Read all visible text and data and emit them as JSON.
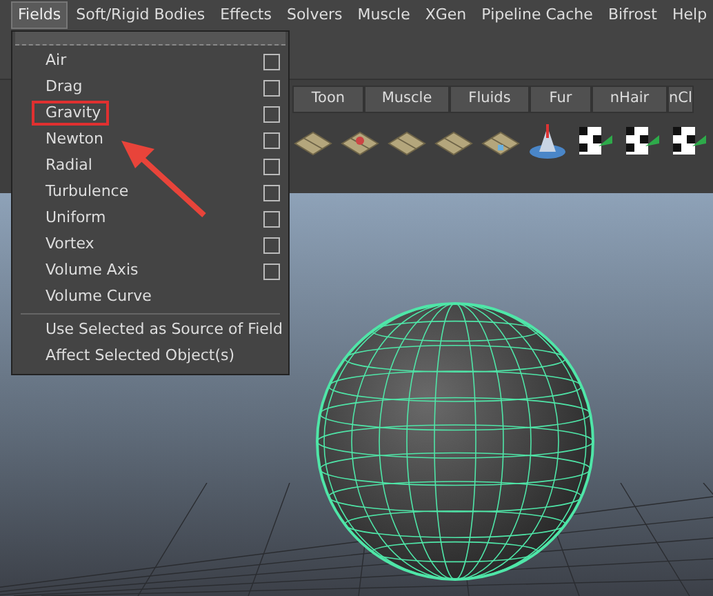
{
  "menu_bar": [
    {
      "label": "Fields",
      "selected": true
    },
    {
      "label": "Soft/Rigid Bodies",
      "selected": false
    },
    {
      "label": "Effects",
      "selected": false
    },
    {
      "label": "Solvers",
      "selected": false
    },
    {
      "label": "Muscle",
      "selected": false
    },
    {
      "label": "XGen",
      "selected": false
    },
    {
      "label": "Pipeline Cache",
      "selected": false
    },
    {
      "label": "Bifrost",
      "selected": false
    },
    {
      "label": "Help",
      "selected": false
    }
  ],
  "shelf_tabs": [
    "Toon",
    "Muscle",
    "Fluids",
    "Fur",
    "nHair",
    "nCl"
  ],
  "dropdown": {
    "items": [
      {
        "label": "Air",
        "kind": "option"
      },
      {
        "label": "Drag",
        "kind": "option"
      },
      {
        "label": "Gravity",
        "kind": "option",
        "highlighted": true
      },
      {
        "label": "Newton",
        "kind": "option"
      },
      {
        "label": "Radial",
        "kind": "option"
      },
      {
        "label": "Turbulence",
        "kind": "option"
      },
      {
        "label": "Uniform",
        "kind": "option"
      },
      {
        "label": "Vortex",
        "kind": "option"
      },
      {
        "label": "Volume Axis",
        "kind": "option"
      },
      {
        "label": "Volume Curve",
        "kind": "plain"
      },
      {
        "label": "Use Selected as Source of Field",
        "kind": "action"
      },
      {
        "label": "Affect Selected Object(s)",
        "kind": "action"
      }
    ]
  }
}
